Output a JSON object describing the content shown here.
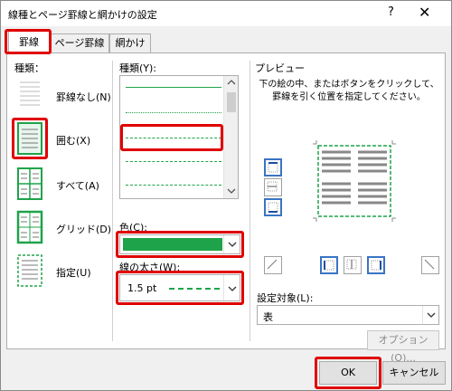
{
  "window": {
    "title": "線種とページ罫線と網かけの設定",
    "help_label": "?",
    "close_label": "✕"
  },
  "tabs": [
    {
      "label": "罫線"
    },
    {
      "label": "ページ罫線"
    },
    {
      "label": "網かけ"
    }
  ],
  "settings": {
    "heading": "種類：",
    "items": [
      {
        "label": "罫線なし(N)"
      },
      {
        "label": "囲む(X)"
      },
      {
        "label": "すべて(A)"
      },
      {
        "label": "グリッド(D)"
      },
      {
        "label": "指定(U)"
      }
    ]
  },
  "style": {
    "heading": "種類(Y):",
    "color_heading": "色(C):",
    "color_value": "#1fa34a",
    "width_heading": "線の太さ(W):",
    "width_value": "1.5 pt"
  },
  "preview": {
    "heading": "プレビュー",
    "instruction": "下の絵の中、またはボタンをクリックして、罫線を引く位置を指定してください。",
    "line_color": "#1fa34a"
  },
  "apply_to": {
    "heading": "設定対象(L):",
    "value": "表"
  },
  "buttons": {
    "options": "オプション(O)...",
    "ok": "OK",
    "cancel": "キャンセル"
  },
  "colors": {
    "highlight": "#e00000",
    "accent": "#1fa34a",
    "selection": "#3a74c4"
  }
}
